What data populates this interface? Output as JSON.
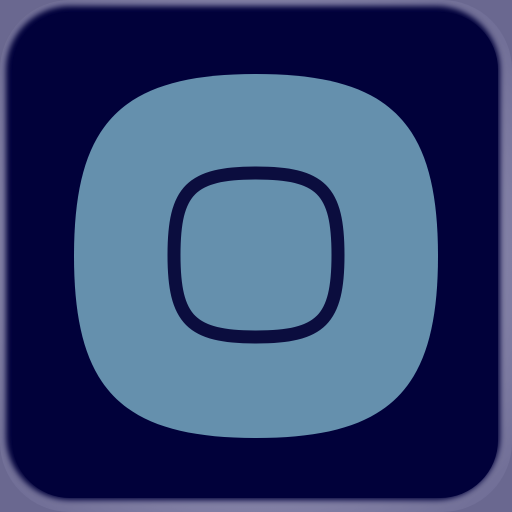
{
  "icon": {
    "name": "rounded-square-app-icon",
    "glyph": "squircle-outline-icon"
  },
  "colors": {
    "frame_outer": "#8a88ad",
    "frame_inner": "#01013a",
    "tile": "#6590ad",
    "glyph_stroke": "#0b0d3e"
  }
}
